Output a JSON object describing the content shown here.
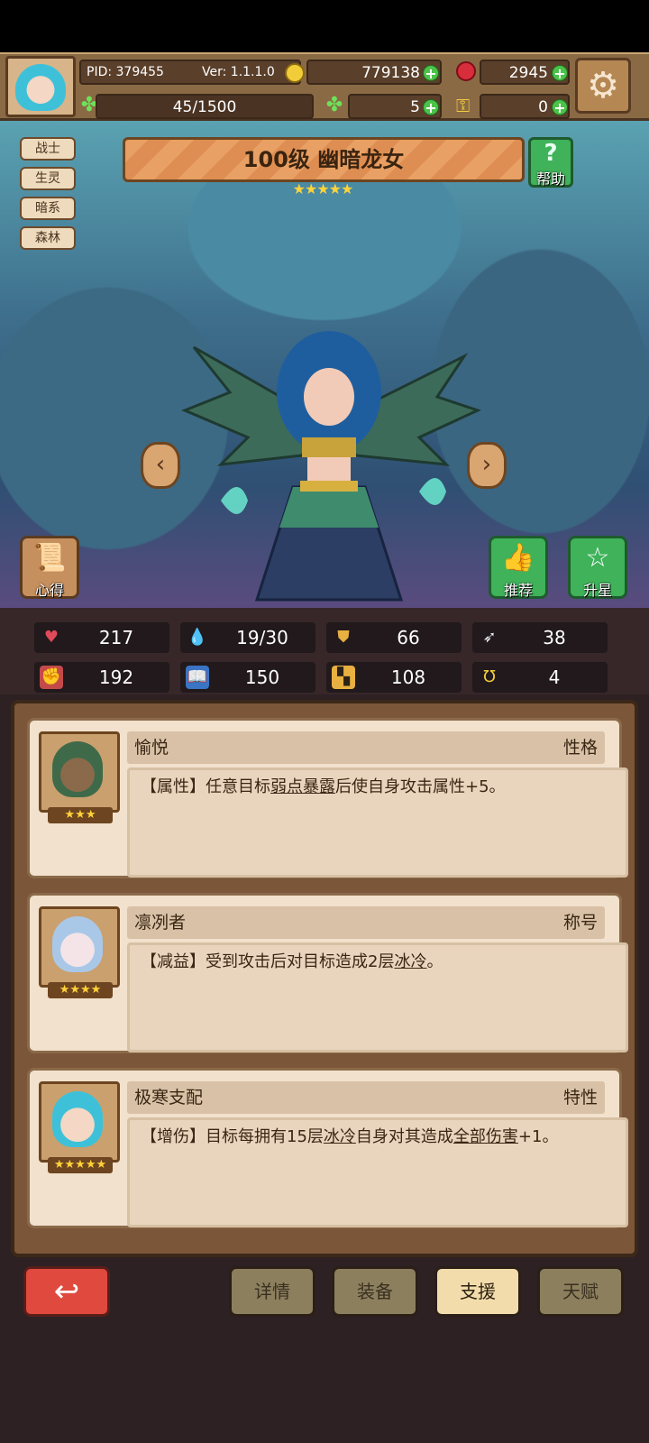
{
  "header": {
    "pid": "PID: 379455",
    "version": "Ver: 1.1.1.0",
    "gold": "779138",
    "gems": "2945",
    "exp": "45/1500",
    "clover_count": "5",
    "key_count": "0"
  },
  "tags": [
    "战士",
    "生灵",
    "暗系",
    "森林"
  ],
  "hero": {
    "title": "100级  幽暗龙女",
    "stars": "★★★★★",
    "help_label": "帮助",
    "insight_label": "心得",
    "recommend_label": "推荐",
    "star_up_label": "升星"
  },
  "stats": {
    "hp": "217",
    "mana": "19/30",
    "defense": "66",
    "speed": "38",
    "attack": "192",
    "magic": "150",
    "resist": "108",
    "luck": "4"
  },
  "cards": [
    {
      "name": "愉悦",
      "kind": "性格",
      "stars": "★★★",
      "desc_prefix": "【属性】任意目标",
      "desc_link": "弱点暴露",
      "desc_suffix": "后使自身攻击属性+5。"
    },
    {
      "name": "凛冽者",
      "kind": "称号",
      "stars": "★★★★",
      "desc_prefix": "【减益】受到攻击后对目标造成2层",
      "desc_link": "冰冷",
      "desc_suffix": "。"
    },
    {
      "name": "极寒支配",
      "kind": "特性",
      "stars": "★★★★★",
      "desc_prefix": "【增伤】目标每拥有15层",
      "desc_link": "冰冷",
      "desc_mid": "自身对其造成",
      "desc_link2": "全部伤害",
      "desc_suffix": "+1。"
    }
  ],
  "tabs": [
    "详情",
    "装备",
    "支援",
    "天赋"
  ],
  "active_tab": "支援",
  "colors": {
    "accent": "#e9a064",
    "active_tab": "#f2dcab",
    "back_button": "#e04a3e"
  }
}
